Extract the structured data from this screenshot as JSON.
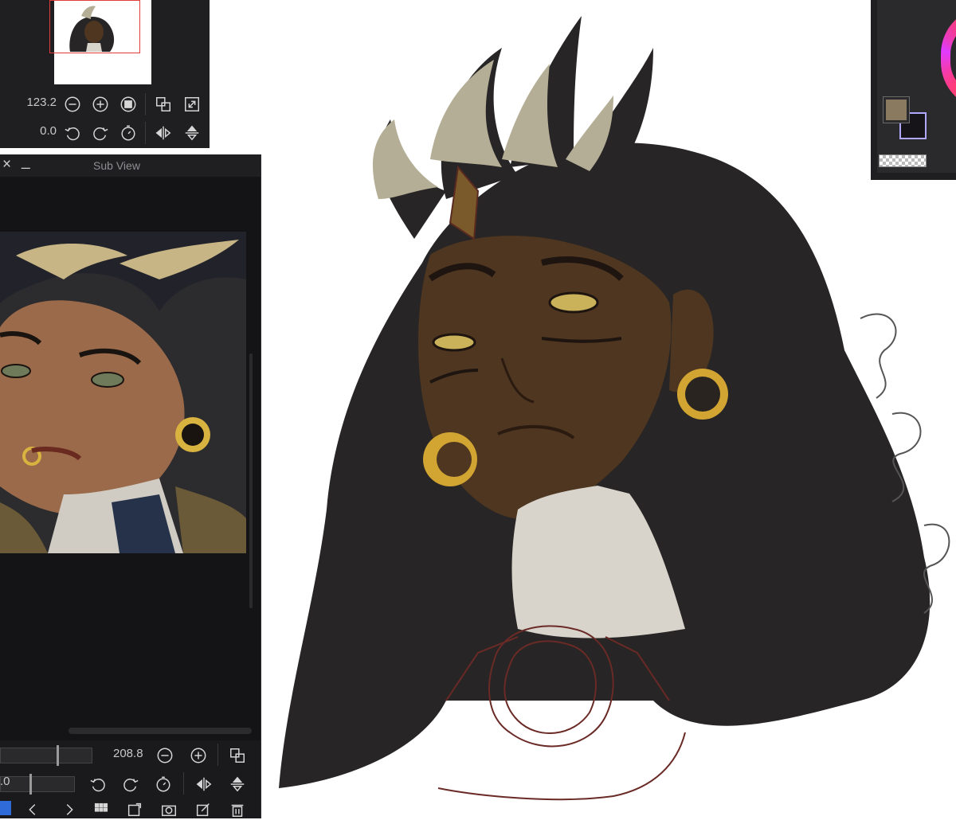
{
  "navigator": {
    "zoom_value": "123.2",
    "rotation_value": "0.0"
  },
  "subview": {
    "title": "Sub View",
    "zoom_value": "208.8",
    "rotation_value": ".0"
  },
  "colors": {
    "foreground": "#8a7a60",
    "background": "#161418",
    "panel_bg": "#1f1f21"
  }
}
